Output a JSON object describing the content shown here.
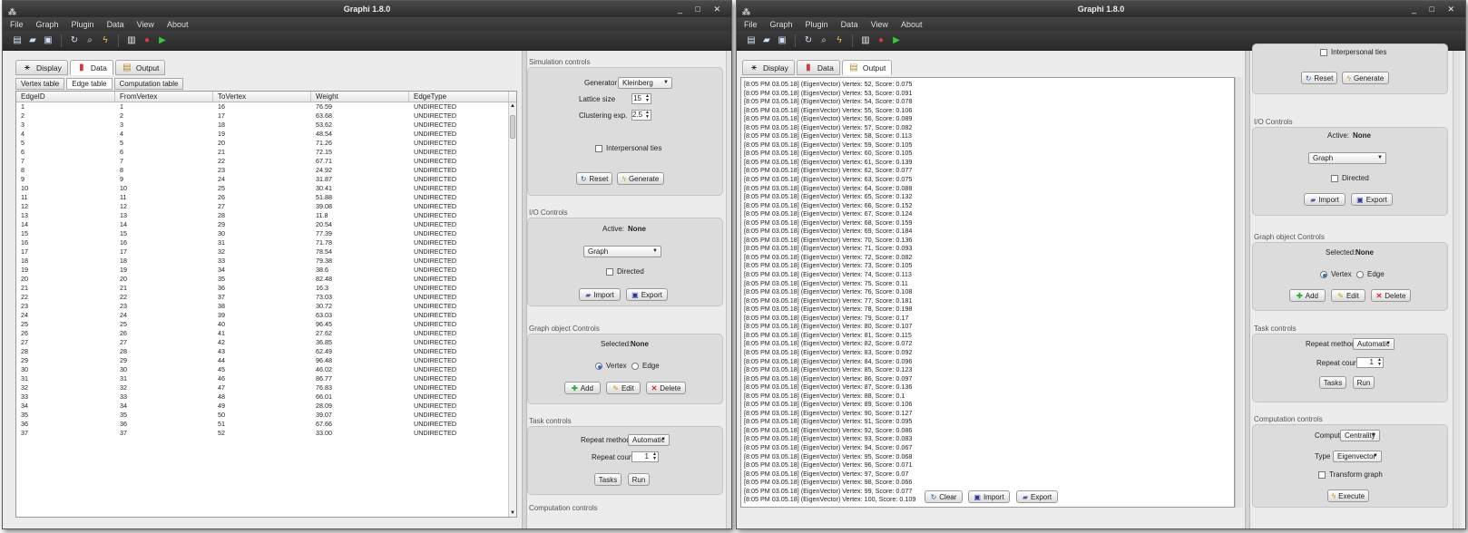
{
  "app": {
    "title": "Graphi 1.8.0",
    "menu": [
      "File",
      "Graph",
      "Plugin",
      "Data",
      "View",
      "About"
    ],
    "win_controls": "_ □ ✕"
  },
  "tabs": {
    "display": "Display",
    "data": "Data",
    "output": "Output"
  },
  "subtabs": {
    "vertex": "Vertex table",
    "edge": "Edge table",
    "computation": "Computation table"
  },
  "edge_table": {
    "headers": [
      "EdgeID",
      "FromVertex",
      "ToVertex",
      "Weight",
      "EdgeType"
    ],
    "rows": [
      [
        "1",
        "1",
        "16",
        "76.59",
        "UNDIRECTED"
      ],
      [
        "2",
        "2",
        "17",
        "63.68",
        "UNDIRECTED"
      ],
      [
        "3",
        "3",
        "18",
        "53.62",
        "UNDIRECTED"
      ],
      [
        "4",
        "4",
        "19",
        "48.54",
        "UNDIRECTED"
      ],
      [
        "5",
        "5",
        "20",
        "71.26",
        "UNDIRECTED"
      ],
      [
        "6",
        "6",
        "21",
        "72.15",
        "UNDIRECTED"
      ],
      [
        "7",
        "7",
        "22",
        "67.71",
        "UNDIRECTED"
      ],
      [
        "8",
        "8",
        "23",
        "24.92",
        "UNDIRECTED"
      ],
      [
        "9",
        "9",
        "24",
        "31.87",
        "UNDIRECTED"
      ],
      [
        "10",
        "10",
        "25",
        "30.41",
        "UNDIRECTED"
      ],
      [
        "11",
        "11",
        "26",
        "51.88",
        "UNDIRECTED"
      ],
      [
        "12",
        "12",
        "27",
        "39.08",
        "UNDIRECTED"
      ],
      [
        "13",
        "13",
        "28",
        "11.8",
        "UNDIRECTED"
      ],
      [
        "14",
        "14",
        "29",
        "20.54",
        "UNDIRECTED"
      ],
      [
        "15",
        "15",
        "30",
        "77.39",
        "UNDIRECTED"
      ],
      [
        "16",
        "16",
        "31",
        "71.78",
        "UNDIRECTED"
      ],
      [
        "17",
        "17",
        "32",
        "78.54",
        "UNDIRECTED"
      ],
      [
        "18",
        "18",
        "33",
        "79.38",
        "UNDIRECTED"
      ],
      [
        "19",
        "19",
        "34",
        "38.6",
        "UNDIRECTED"
      ],
      [
        "20",
        "20",
        "35",
        "82.48",
        "UNDIRECTED"
      ],
      [
        "21",
        "21",
        "36",
        "16.3",
        "UNDIRECTED"
      ],
      [
        "22",
        "22",
        "37",
        "73.03",
        "UNDIRECTED"
      ],
      [
        "23",
        "23",
        "38",
        "30.72",
        "UNDIRECTED"
      ],
      [
        "24",
        "24",
        "39",
        "63.03",
        "UNDIRECTED"
      ],
      [
        "25",
        "25",
        "40",
        "96.45",
        "UNDIRECTED"
      ],
      [
        "26",
        "26",
        "41",
        "27.62",
        "UNDIRECTED"
      ],
      [
        "27",
        "27",
        "42",
        "36.85",
        "UNDIRECTED"
      ],
      [
        "28",
        "28",
        "43",
        "62.49",
        "UNDIRECTED"
      ],
      [
        "29",
        "29",
        "44",
        "96.48",
        "UNDIRECTED"
      ],
      [
        "30",
        "30",
        "45",
        "46.02",
        "UNDIRECTED"
      ],
      [
        "31",
        "31",
        "46",
        "86.77",
        "UNDIRECTED"
      ],
      [
        "32",
        "32",
        "47",
        "76.83",
        "UNDIRECTED"
      ],
      [
        "33",
        "33",
        "48",
        "66.01",
        "UNDIRECTED"
      ],
      [
        "34",
        "34",
        "49",
        "28.09",
        "UNDIRECTED"
      ],
      [
        "35",
        "35",
        "50",
        "39.07",
        "UNDIRECTED"
      ],
      [
        "36",
        "36",
        "51",
        "67.66",
        "UNDIRECTED"
      ],
      [
        "37",
        "37",
        "52",
        "33.00",
        "UNDIRECTED"
      ]
    ]
  },
  "sim": {
    "title": "Simulation controls",
    "generator_label": "Generator",
    "generator_value": "Kleinberg",
    "lattice_label": "Lattice size",
    "lattice_value": "15",
    "clustering_label": "Clustering exp.",
    "clustering_value": "2.5",
    "ties_label": "Interpersonal ties",
    "reset": "Reset",
    "generate": "Generate"
  },
  "io": {
    "title": "I/O Controls",
    "active_label": "Active:",
    "active_value": "None",
    "type_value": "Graph",
    "directed_label": "Directed",
    "import": "Import",
    "export": "Export"
  },
  "gobj": {
    "title": "Graph object Controls",
    "selected_label": "Selected:",
    "selected_value": "None",
    "vertex": "Vertex",
    "edge": "Edge",
    "add": "Add",
    "edit": "Edit",
    "delete": "Delete"
  },
  "task": {
    "title": "Task controls",
    "repeat_method_label": "Repeat method",
    "repeat_method_value": "Automatic",
    "repeat_count_label": "Repeat count",
    "repeat_count_value": "1",
    "tasks": "Tasks",
    "run": "Run"
  },
  "comp": {
    "title": "Computation controls",
    "compute_label": "Compute",
    "compute_value": "Centrality",
    "type_label": "Type",
    "type_value": "Eigenvector",
    "transform_label": "Transform graph",
    "execute": "Execute"
  },
  "output": {
    "lines": [
      "[8:05 PM 03.05.18] (EigenVector) Vertex: 52, Score: 0.075",
      "[8:05 PM 03.05.18] (EigenVector) Vertex: 53, Score: 0.091",
      "[8:05 PM 03.05.18] (EigenVector) Vertex: 54, Score: 0.078",
      "[8:05 PM 03.05.18] (EigenVector) Vertex: 55, Score: 0.106",
      "[8:05 PM 03.05.18] (EigenVector) Vertex: 56, Score: 0.089",
      "[8:05 PM 03.05.18] (EigenVector) Vertex: 57, Score: 0.082",
      "[8:05 PM 03.05.18] (EigenVector) Vertex: 58, Score: 0.113",
      "[8:05 PM 03.05.18] (EigenVector) Vertex: 59, Score: 0.105",
      "[8:05 PM 03.05.18] (EigenVector) Vertex: 60, Score: 0.105",
      "[8:05 PM 03.05.18] (EigenVector) Vertex: 61, Score: 0.139",
      "[8:05 PM 03.05.18] (EigenVector) Vertex: 62, Score: 0.077",
      "[8:05 PM 03.05.18] (EigenVector) Vertex: 63, Score: 0.075",
      "[8:05 PM 03.05.18] (EigenVector) Vertex: 64, Score: 0.088",
      "[8:05 PM 03.05.18] (EigenVector) Vertex: 65, Score: 0.132",
      "[8:05 PM 03.05.18] (EigenVector) Vertex: 66, Score: 0.152",
      "[8:05 PM 03.05.18] (EigenVector) Vertex: 67, Score: 0.124",
      "[8:05 PM 03.05.18] (EigenVector) Vertex: 68, Score: 0.159",
      "[8:05 PM 03.05.18] (EigenVector) Vertex: 69, Score: 0.184",
      "[8:05 PM 03.05.18] (EigenVector) Vertex: 70, Score: 0.136",
      "[8:05 PM 03.05.18] (EigenVector) Vertex: 71, Score: 0.093",
      "[8:05 PM 03.05.18] (EigenVector) Vertex: 72, Score: 0.082",
      "[8:05 PM 03.05.18] (EigenVector) Vertex: 73, Score: 0.105",
      "[8:05 PM 03.05.18] (EigenVector) Vertex: 74, Score: 0.113",
      "[8:05 PM 03.05.18] (EigenVector) Vertex: 75, Score: 0.11",
      "[8:05 PM 03.05.18] (EigenVector) Vertex: 76, Score: 0.108",
      "[8:05 PM 03.05.18] (EigenVector) Vertex: 77, Score: 0.181",
      "[8:05 PM 03.05.18] (EigenVector) Vertex: 78, Score: 0.198",
      "[8:05 PM 03.05.18] (EigenVector) Vertex: 79, Score: 0.17",
      "[8:05 PM 03.05.18] (EigenVector) Vertex: 80, Score: 0.107",
      "[8:05 PM 03.05.18] (EigenVector) Vertex: 81, Score: 0.115",
      "[8:05 PM 03.05.18] (EigenVector) Vertex: 82, Score: 0.072",
      "[8:05 PM 03.05.18] (EigenVector) Vertex: 83, Score: 0.092",
      "[8:05 PM 03.05.18] (EigenVector) Vertex: 84, Score: 0.096",
      "[8:05 PM 03.05.18] (EigenVector) Vertex: 85, Score: 0.123",
      "[8:05 PM 03.05.18] (EigenVector) Vertex: 86, Score: 0.097",
      "[8:05 PM 03.05.18] (EigenVector) Vertex: 87, Score: 0.136",
      "[8:05 PM 03.05.18] (EigenVector) Vertex: 88, Score: 0.1",
      "[8:05 PM 03.05.18] (EigenVector) Vertex: 89, Score: 0.106",
      "[8:05 PM 03.05.18] (EigenVector) Vertex: 90, Score: 0.127",
      "[8:05 PM 03.05.18] (EigenVector) Vertex: 91, Score: 0.095",
      "[8:05 PM 03.05.18] (EigenVector) Vertex: 92, Score: 0.086",
      "[8:05 PM 03.05.18] (EigenVector) Vertex: 93, Score: 0.083",
      "[8:05 PM 03.05.18] (EigenVector) Vertex: 94, Score: 0.067",
      "[8:05 PM 03.05.18] (EigenVector) Vertex: 95, Score: 0.068",
      "[8:05 PM 03.05.18] (EigenVector) Vertex: 96, Score: 0.071",
      "[8:05 PM 03.05.18] (EigenVector) Vertex: 97, Score: 0.07",
      "[8:05 PM 03.05.18] (EigenVector) Vertex: 98, Score: 0.066",
      "[8:05 PM 03.05.18] (EigenVector) Vertex: 99, Score: 0.077",
      "[8:05 PM 03.05.18] (EigenVector) Vertex: 100, Score: 0.109"
    ],
    "clear": "Clear",
    "import": "Import",
    "export": "Export"
  },
  "icons": {
    "reset": "refresh-icon",
    "generate": "wand-icon",
    "import": "folder-icon",
    "export": "save-icon",
    "add": "plus-icon",
    "edit": "pencil-icon",
    "delete": "x-icon",
    "clear": "refresh-icon",
    "execute": "wand-icon"
  }
}
